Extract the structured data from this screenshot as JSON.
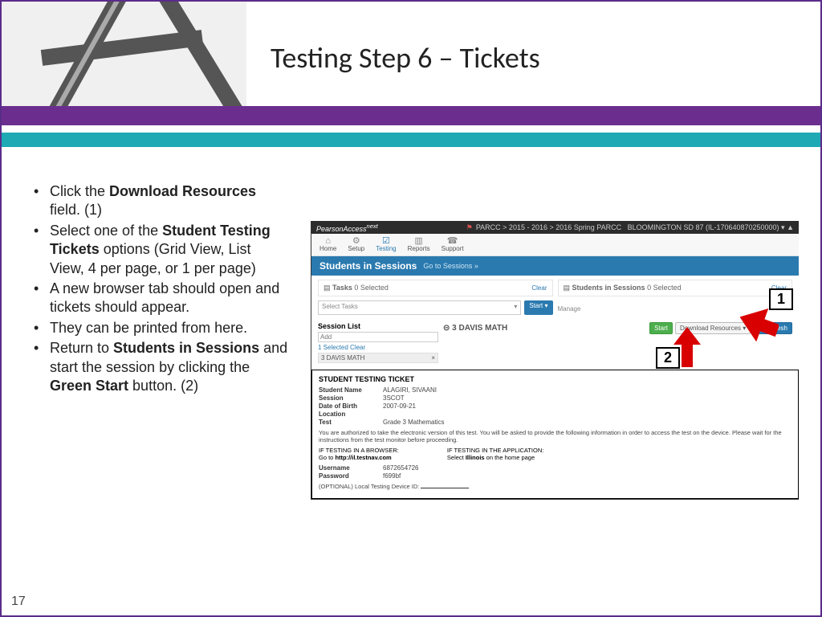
{
  "title": "Testing Step 6 – Tickets",
  "bullets": {
    "b1a": "Click the ",
    "b1b": "Download Resources",
    "b1c": " field. (1)",
    "b2a": "Select one of the ",
    "b2b": "Student Testing Tickets",
    "b2c": " options (Grid View, List View, 4 per page, or 1 per page)",
    "b3": "A new browser tab should open and tickets should appear.",
    "b4": "They can be printed from here.",
    "b5a": "Return to ",
    "b5b": "Students in Sessions",
    "b5c": " and start the session by clicking the ",
    "b5d": "Green Start",
    "b5e": " button.  (2)"
  },
  "pageNumber": "17",
  "pa": {
    "brand": "PearsonAccess",
    "brandSup": "next",
    "crumb": "PARCC > 2015 - 2016 > 2016 Spring PARCC",
    "org": "BLOOMINGTON SD 87 (IL-170640870250000) ▾",
    "nav": {
      "home": "Home",
      "setup": "Setup",
      "testing": "Testing",
      "reports": "Reports",
      "support": "Support"
    },
    "blueTitle": "Students in Sessions",
    "blueSub": "Go to Sessions »",
    "tasksLabel": "Tasks",
    "tasksCount": "0 Selected",
    "selectTasks": "Select Tasks",
    "startDrop": "Start ▾",
    "sisLabel": "Students in Sessions",
    "sisCount": "0 Selected",
    "clear": "Clear",
    "manage": "Manage",
    "sessionListTitle": "Session List",
    "addPH": "Add",
    "selectedRow": "1 Selected  Clear",
    "sessionItem": "3 DAVIS MATH",
    "sessionMainTitle": "⊝ 3 DAVIS MATH",
    "startBtn": "Start",
    "downloadBtn": "Download Resources ▾",
    "refreshBtn": "Refresh"
  },
  "callouts": {
    "c1": "1",
    "c2": "2"
  },
  "ticket": {
    "title": "STUDENT TESTING TICKET",
    "name_l": "Student Name",
    "name_v": "ALAGIRI, SIVAANI",
    "sess_l": "Session",
    "sess_v": "3SCOT",
    "dob_l": "Date of Birth",
    "dob_v": "2007-09-21",
    "loc_l": "Location",
    "loc_v": "",
    "test_l": "Test",
    "test_v": "Grade 3 Mathematics",
    "note": "You are authorized to take the electronic version of this test. You will be asked to provide the following information in order to access the test on the device. Please wait for the instructions from the test monitor before proceeding.",
    "colA_h": "IF TESTING IN A BROWSER:",
    "colA_t": "Go to http://il.testnav.com",
    "colB_h": "IF TESTING IN THE APPLICATION:",
    "colB_t": "Select Illinois on the home page",
    "user_l": "Username",
    "user_v": "6872654726",
    "pass_l": "Password",
    "pass_v": "f699bf",
    "device": "(OPTIONAL) Local Testing Device ID: "
  }
}
